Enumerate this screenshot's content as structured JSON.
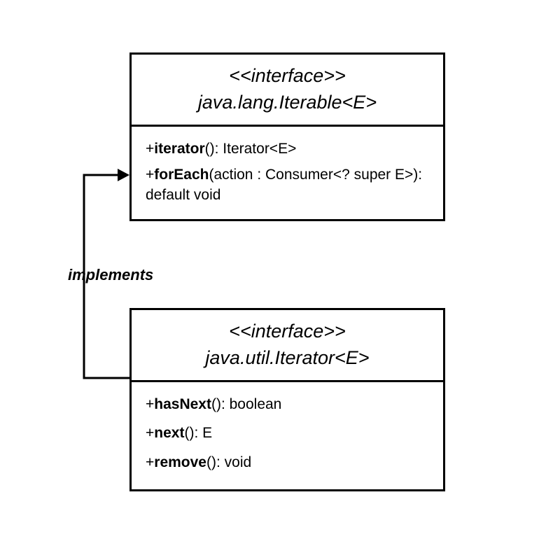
{
  "iterable": {
    "stereotype": "<<interface>>",
    "name": "java.lang.Iterable<E>",
    "methods": [
      {
        "prefix": "+",
        "name": "iterator",
        "signature": "(): Iterator<E>"
      },
      {
        "prefix": "+",
        "name": "forEach",
        "signature": "(action : Consumer<? super E>): default void"
      }
    ]
  },
  "iterator": {
    "stereotype": "<<interface>>",
    "name": "java.util.Iterator<E>",
    "methods": [
      {
        "prefix": "+",
        "name": "hasNext",
        "signature": "(): boolean"
      },
      {
        "prefix": "+",
        "name": "next",
        "signature": "(): E"
      },
      {
        "prefix": "+",
        "name": "remove",
        "signature": "(): void"
      }
    ]
  },
  "relationship": {
    "label": "implements"
  }
}
